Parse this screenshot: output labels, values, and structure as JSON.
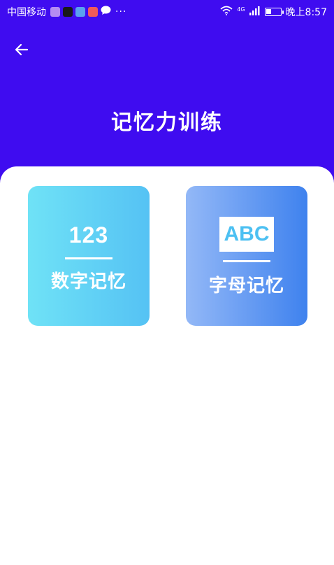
{
  "status_bar": {
    "carrier": "中国移动",
    "more": "···",
    "network": "4G",
    "time": "晚上8:57",
    "app_icon_colors": [
      "#b58cf2",
      "#1a1a1a",
      "#5aa0f0",
      "#f05a5a"
    ]
  },
  "header": {
    "back_icon": "arrow-left-icon",
    "title": "记忆力训练",
    "background": "#3f0cf0"
  },
  "tiles": [
    {
      "symbol": "123",
      "label": "数字记忆"
    },
    {
      "symbol": "ABC",
      "label": "字母记忆"
    }
  ]
}
